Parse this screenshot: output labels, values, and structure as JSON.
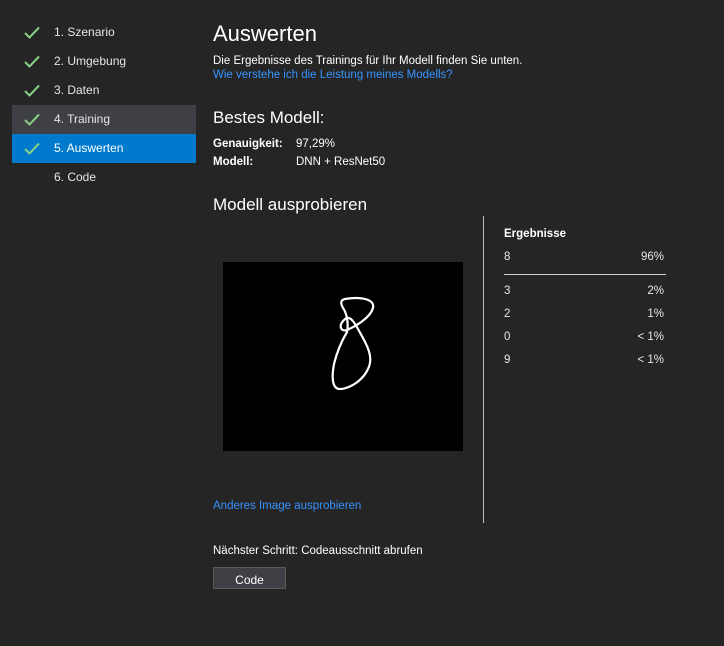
{
  "steps": [
    {
      "label": "1. Szenario",
      "done": true
    },
    {
      "label": "2. Umgebung",
      "done": true
    },
    {
      "label": "3. Daten",
      "done": true
    },
    {
      "label": "4. Training",
      "done": true
    },
    {
      "label": "5. Auswerten",
      "done": true
    },
    {
      "label": "6. Code",
      "done": false
    }
  ],
  "header": {
    "title": "Auswerten",
    "description": "Die Ergebnisse des Trainings für Ihr Modell finden Sie unten.",
    "help_link": "Wie verstehe ich die Leistung meines Modells?"
  },
  "best_model": {
    "heading": "Bestes Modell:",
    "accuracy_label": "Genauigkeit:",
    "accuracy_value": "97,29%",
    "model_label": "Modell:",
    "model_value": "DNN + ResNet50"
  },
  "try_model": {
    "heading": "Modell ausprobieren",
    "other_image_link": "Anderes Image ausprobieren"
  },
  "results": {
    "heading": "Ergebnisse",
    "top": {
      "label": "8",
      "percent": "96%"
    },
    "rows": [
      {
        "label": "3",
        "percent": "2%"
      },
      {
        "label": "2",
        "percent": "1%"
      },
      {
        "label": "0",
        "percent": "< 1%"
      },
      {
        "label": "9",
        "percent": "< 1%"
      }
    ]
  },
  "next_step": {
    "text": "Nächster Schritt: Codeausschnitt abrufen",
    "button_label": "Code"
  },
  "colors": {
    "background": "#252526",
    "active_step": "#007acc",
    "hover_step": "#3f3f46",
    "check": "#89d185",
    "link": "#3794ff"
  },
  "icons": {
    "step_done": "checkmark-icon"
  }
}
